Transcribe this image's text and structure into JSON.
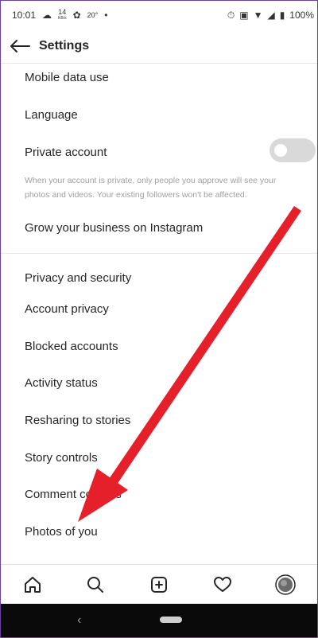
{
  "status": {
    "time": "10:01",
    "speed_top": "14",
    "speed_unit": "KB/s",
    "temperature": "20°",
    "dot": "•",
    "battery": "100%"
  },
  "header": {
    "title": "Settings"
  },
  "items": {
    "mobile_data": "Mobile data use",
    "language": "Language",
    "private_account": "Private account",
    "private_help": "When your account is private, only people you approve will see your photos and videos. Your existing followers won't be affected.",
    "grow_business": "Grow your business on Instagram",
    "privacy_header": "Privacy and security",
    "account_privacy": "Account privacy",
    "blocked": "Blocked accounts",
    "activity": "Activity status",
    "resharing": "Resharing to stories",
    "story_controls": "Story controls",
    "comment_controls": "Comment controls",
    "photos_of_you": "Photos of you"
  },
  "toggle": {
    "private_account_on": false
  },
  "colors": {
    "arrow": "#e5202a"
  }
}
